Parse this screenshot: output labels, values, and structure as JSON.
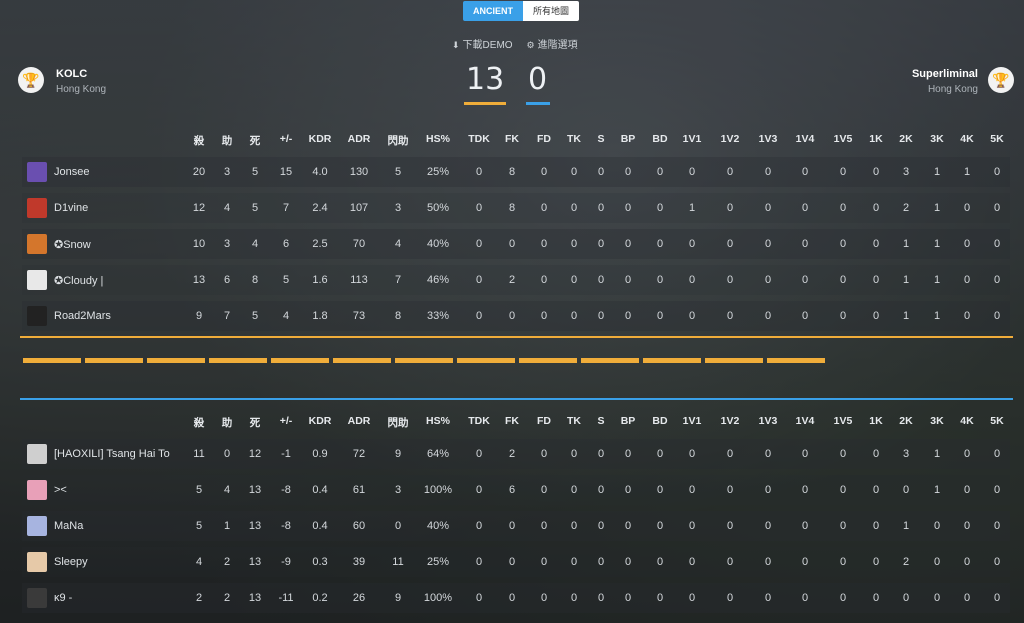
{
  "map_tabs": [
    {
      "label": "ANCIENT",
      "active": true
    },
    {
      "label": "所有地圖",
      "active": false
    }
  ],
  "links": {
    "download_demo": "下載DEMO",
    "advanced_options": "進階選項"
  },
  "team1": {
    "name": "KOLC",
    "location": "Hong Kong",
    "score": "13",
    "color": "#f0ad3a"
  },
  "team2": {
    "name": "Superliminal",
    "location": "Hong Kong",
    "score": "0",
    "color": "#3aa0e8"
  },
  "columns": [
    "殺",
    "助",
    "死",
    "+/-",
    "KDR",
    "ADR",
    "閃助",
    "HS%",
    "TDK",
    "FK",
    "FD",
    "TK",
    "S",
    "BP",
    "BD",
    "1V1",
    "1V2",
    "1V3",
    "1V4",
    "1V5",
    "1K",
    "2K",
    "3K",
    "4K",
    "5K"
  ],
  "team1_players": [
    {
      "name": "Jonsee",
      "avatar": "#6a4fb0",
      "stats": [
        "20",
        "3",
        "5",
        "15",
        "4.0",
        "130",
        "5",
        "25%",
        "0",
        "8",
        "0",
        "0",
        "0",
        "0",
        "0",
        "0",
        "0",
        "0",
        "0",
        "0",
        "0",
        "3",
        "1",
        "1",
        "0"
      ]
    },
    {
      "name": "D1vine",
      "avatar": "#c0392b",
      "stats": [
        "12",
        "4",
        "5",
        "7",
        "2.4",
        "107",
        "3",
        "50%",
        "0",
        "8",
        "0",
        "0",
        "0",
        "0",
        "0",
        "1",
        "0",
        "0",
        "0",
        "0",
        "0",
        "2",
        "1",
        "0",
        "0"
      ]
    },
    {
      "name": "✪Snow",
      "avatar": "#d4762c",
      "stats": [
        "10",
        "3",
        "4",
        "6",
        "2.5",
        "70",
        "4",
        "40%",
        "0",
        "0",
        "0",
        "0",
        "0",
        "0",
        "0",
        "0",
        "0",
        "0",
        "0",
        "0",
        "0",
        "1",
        "1",
        "0",
        "0"
      ]
    },
    {
      "name": "✪Cloudy |",
      "avatar": "#e8e8e8",
      "stats": [
        "13",
        "6",
        "8",
        "5",
        "1.6",
        "113",
        "7",
        "46%",
        "0",
        "2",
        "0",
        "0",
        "0",
        "0",
        "0",
        "0",
        "0",
        "0",
        "0",
        "0",
        "0",
        "1",
        "1",
        "0",
        "0"
      ]
    },
    {
      "name": "Road2Mars",
      "avatar": "#222222",
      "stats": [
        "9",
        "7",
        "5",
        "4",
        "1.8",
        "73",
        "8",
        "33%",
        "0",
        "0",
        "0",
        "0",
        "0",
        "0",
        "0",
        "0",
        "0",
        "0",
        "0",
        "0",
        "0",
        "1",
        "1",
        "0",
        "0"
      ]
    }
  ],
  "team2_players": [
    {
      "name": "[HAOXILI] Tsang Hai To",
      "avatar": "#cfcfcf",
      "stats": [
        "11",
        "0",
        "12",
        "-1",
        "0.9",
        "72",
        "9",
        "64%",
        "0",
        "2",
        "0",
        "0",
        "0",
        "0",
        "0",
        "0",
        "0",
        "0",
        "0",
        "0",
        "0",
        "3",
        "1",
        "0",
        "0"
      ]
    },
    {
      "name": "><",
      "avatar": "#e8a0b8",
      "stats": [
        "5",
        "4",
        "13",
        "-8",
        "0.4",
        "61",
        "3",
        "100%",
        "0",
        "6",
        "0",
        "0",
        "0",
        "0",
        "0",
        "0",
        "0",
        "0",
        "0",
        "0",
        "0",
        "0",
        "1",
        "0",
        "0"
      ]
    },
    {
      "name": "MaNa",
      "avatar": "#a7b4e0",
      "stats": [
        "5",
        "1",
        "13",
        "-8",
        "0.4",
        "60",
        "0",
        "40%",
        "0",
        "0",
        "0",
        "0",
        "0",
        "0",
        "0",
        "0",
        "0",
        "0",
        "0",
        "0",
        "0",
        "1",
        "0",
        "0",
        "0"
      ]
    },
    {
      "name": "Sleepy",
      "avatar": "#e6c9a8",
      "stats": [
        "4",
        "2",
        "13",
        "-9",
        "0.3",
        "39",
        "11",
        "25%",
        "0",
        "0",
        "0",
        "0",
        "0",
        "0",
        "0",
        "0",
        "0",
        "0",
        "0",
        "0",
        "0",
        "2",
        "0",
        "0",
        "0"
      ]
    },
    {
      "name": "ĸ9 -",
      "avatar": "#3a3a3a",
      "stats": [
        "2",
        "2",
        "13",
        "-11",
        "0.2",
        "26",
        "9",
        "100%",
        "0",
        "0",
        "0",
        "0",
        "0",
        "0",
        "0",
        "0",
        "0",
        "0",
        "0",
        "0",
        "0",
        "0",
        "0",
        "0",
        "0"
      ]
    }
  ],
  "round_segments": 13
}
